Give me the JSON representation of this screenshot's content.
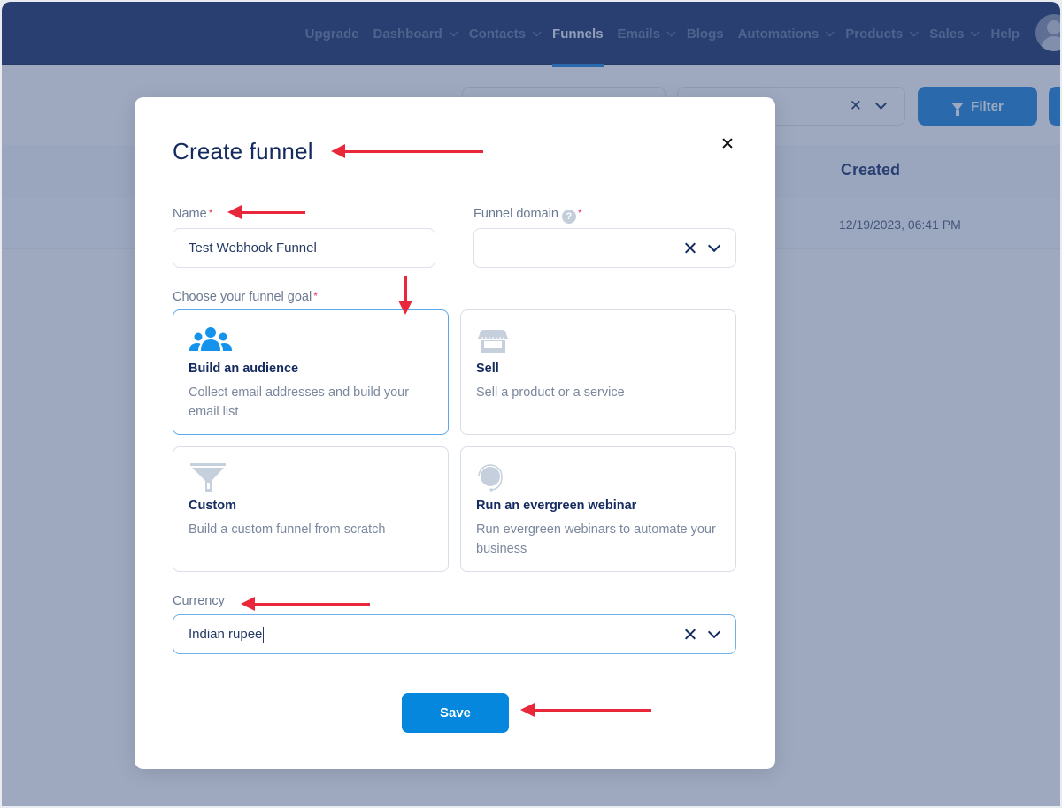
{
  "nav": {
    "items": [
      {
        "label": "Upgrade",
        "has_dropdown": false,
        "active": false
      },
      {
        "label": "Dashboard",
        "has_dropdown": true,
        "active": false
      },
      {
        "label": "Contacts",
        "has_dropdown": true,
        "active": false
      },
      {
        "label": "Funnels",
        "has_dropdown": false,
        "active": true
      },
      {
        "label": "Emails",
        "has_dropdown": true,
        "active": false
      },
      {
        "label": "Blogs",
        "has_dropdown": false,
        "active": false
      },
      {
        "label": "Automations",
        "has_dropdown": true,
        "active": false
      },
      {
        "label": "Products",
        "has_dropdown": true,
        "active": false
      },
      {
        "label": "Sales",
        "has_dropdown": true,
        "active": false
      },
      {
        "label": "Help",
        "has_dropdown": false,
        "active": false
      }
    ],
    "avatar_icon": "user-avatar-icon"
  },
  "background": {
    "filter_label": "Filter",
    "table_header_created": "Created",
    "row_created": "12/19/2023, 06:41 PM"
  },
  "modal": {
    "title": "Create funnel",
    "close_icon": "close-icon",
    "name": {
      "label": "Name",
      "required_mark": "*",
      "value": "Test Webhook Funnel"
    },
    "funnel_domain": {
      "label": "Funnel domain",
      "help_glyph": "?",
      "required_mark": "*",
      "value": ""
    },
    "goal": {
      "label": "Choose your funnel goal",
      "required_mark": "*",
      "options": [
        {
          "title": "Build an audience",
          "description": "Collect email addresses and build your email list",
          "icon": "audience-icon",
          "selected": true
        },
        {
          "title": "Sell",
          "description": "Sell a product or a service",
          "icon": "store-icon",
          "selected": false
        },
        {
          "title": "Custom",
          "description": "Build a custom funnel from scratch",
          "icon": "funnel-icon",
          "selected": false
        },
        {
          "title": "Run an evergreen webinar",
          "description": "Run evergreen webinars to automate your business",
          "icon": "headset-icon",
          "selected": false
        }
      ]
    },
    "currency": {
      "label": "Currency",
      "value": "Indian rupee"
    },
    "save_label": "Save"
  },
  "colors": {
    "nav_bg": "#152b60",
    "accent": "#0487dc",
    "selected_border": "#5aa8ea",
    "annotation": "#e8283a",
    "required": "#e53a5a"
  }
}
